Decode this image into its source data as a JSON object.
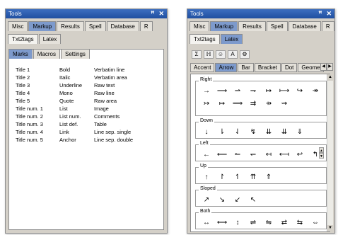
{
  "left": {
    "title": "Tools",
    "pin_icon": "pin-icon",
    "close_icon": "close-icon",
    "tabs": [
      "Misc",
      "Markup",
      "Results",
      "Spell",
      "Database",
      "R"
    ],
    "subtabs": [
      "Txt2tags",
      "Latex"
    ],
    "marktabs": [
      "Marks",
      "Macros",
      "Settings"
    ],
    "table": [
      [
        "Title 1",
        "Bold",
        "Verbatim line"
      ],
      [
        "Title 2",
        "Italic",
        "Verbatim area"
      ],
      [
        "Title 3",
        "Underline",
        "Raw text"
      ],
      [
        "Title 4",
        "Mono",
        "Raw line"
      ],
      [
        "Title 5",
        "Quote",
        "Raw area"
      ],
      [
        "Title num. 1",
        "List",
        "Image"
      ],
      [
        "Title num. 2",
        "List num.",
        "Comments"
      ],
      [
        "Title num. 3",
        "List def.",
        "Table"
      ],
      [
        "Title num. 4",
        "Link",
        "Line sep. single"
      ],
      [
        "Title num. 5",
        "Anchor",
        "Line sep. double"
      ]
    ]
  },
  "right": {
    "title": "Tools",
    "tabs": [
      "Misc",
      "Markup",
      "Results",
      "Spell",
      "Database",
      "R"
    ],
    "subtabs": [
      "Txt2tags",
      "Latex"
    ],
    "toolbar": [
      "Σ",
      "ℍ",
      "☺",
      "A",
      "⚙"
    ],
    "categories": [
      "Accent",
      "Arrow",
      "Bar",
      "Bracket",
      "Dot",
      "Geome"
    ],
    "groups": [
      {
        "label": "Right",
        "symbols": [
          "→",
          "⟶",
          "⇀",
          "⇁",
          "↦",
          "⟼",
          "↪",
          "↠",
          "↣",
          "↦",
          "⟹",
          "⇉",
          "⇸",
          "⇝"
        ]
      },
      {
        "label": "Down",
        "symbols": [
          "↓",
          "⇂",
          "⇃",
          "↯",
          "⇊",
          "⇊",
          "⇓"
        ]
      },
      {
        "label": "Left",
        "symbols": [
          "←",
          "⟵",
          "↼",
          "↽",
          "↤",
          "⟻",
          "↩",
          "↰"
        ]
      },
      {
        "label": "Up",
        "symbols": [
          "↑",
          "↾",
          "↿",
          "⇈",
          "⇑"
        ]
      },
      {
        "label": "Sloped",
        "symbols": [
          "↗",
          "↘",
          "↙",
          "↖"
        ]
      },
      {
        "label": "Both",
        "symbols": [
          "↔",
          "⟷",
          "↕",
          "⇌",
          "⇋",
          "⇄",
          "⇆",
          "⇔"
        ]
      }
    ]
  }
}
